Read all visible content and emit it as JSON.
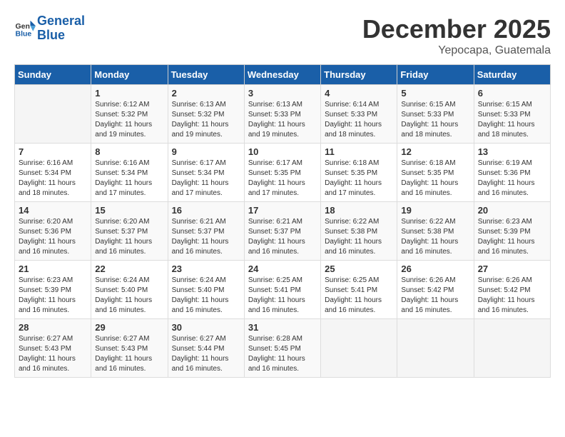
{
  "header": {
    "logo_line1": "General",
    "logo_line2": "Blue",
    "month": "December 2025",
    "location": "Yepocapa, Guatemala"
  },
  "days_of_week": [
    "Sunday",
    "Monday",
    "Tuesday",
    "Wednesday",
    "Thursday",
    "Friday",
    "Saturday"
  ],
  "weeks": [
    [
      {
        "num": "",
        "sunrise": "",
        "sunset": "",
        "daylight": ""
      },
      {
        "num": "1",
        "sunrise": "Sunrise: 6:12 AM",
        "sunset": "Sunset: 5:32 PM",
        "daylight": "Daylight: 11 hours and 19 minutes."
      },
      {
        "num": "2",
        "sunrise": "Sunrise: 6:13 AM",
        "sunset": "Sunset: 5:32 PM",
        "daylight": "Daylight: 11 hours and 19 minutes."
      },
      {
        "num": "3",
        "sunrise": "Sunrise: 6:13 AM",
        "sunset": "Sunset: 5:33 PM",
        "daylight": "Daylight: 11 hours and 19 minutes."
      },
      {
        "num": "4",
        "sunrise": "Sunrise: 6:14 AM",
        "sunset": "Sunset: 5:33 PM",
        "daylight": "Daylight: 11 hours and 18 minutes."
      },
      {
        "num": "5",
        "sunrise": "Sunrise: 6:15 AM",
        "sunset": "Sunset: 5:33 PM",
        "daylight": "Daylight: 11 hours and 18 minutes."
      },
      {
        "num": "6",
        "sunrise": "Sunrise: 6:15 AM",
        "sunset": "Sunset: 5:33 PM",
        "daylight": "Daylight: 11 hours and 18 minutes."
      }
    ],
    [
      {
        "num": "7",
        "sunrise": "Sunrise: 6:16 AM",
        "sunset": "Sunset: 5:34 PM",
        "daylight": "Daylight: 11 hours and 18 minutes."
      },
      {
        "num": "8",
        "sunrise": "Sunrise: 6:16 AM",
        "sunset": "Sunset: 5:34 PM",
        "daylight": "Daylight: 11 hours and 17 minutes."
      },
      {
        "num": "9",
        "sunrise": "Sunrise: 6:17 AM",
        "sunset": "Sunset: 5:34 PM",
        "daylight": "Daylight: 11 hours and 17 minutes."
      },
      {
        "num": "10",
        "sunrise": "Sunrise: 6:17 AM",
        "sunset": "Sunset: 5:35 PM",
        "daylight": "Daylight: 11 hours and 17 minutes."
      },
      {
        "num": "11",
        "sunrise": "Sunrise: 6:18 AM",
        "sunset": "Sunset: 5:35 PM",
        "daylight": "Daylight: 11 hours and 17 minutes."
      },
      {
        "num": "12",
        "sunrise": "Sunrise: 6:18 AM",
        "sunset": "Sunset: 5:35 PM",
        "daylight": "Daylight: 11 hours and 16 minutes."
      },
      {
        "num": "13",
        "sunrise": "Sunrise: 6:19 AM",
        "sunset": "Sunset: 5:36 PM",
        "daylight": "Daylight: 11 hours and 16 minutes."
      }
    ],
    [
      {
        "num": "14",
        "sunrise": "Sunrise: 6:20 AM",
        "sunset": "Sunset: 5:36 PM",
        "daylight": "Daylight: 11 hours and 16 minutes."
      },
      {
        "num": "15",
        "sunrise": "Sunrise: 6:20 AM",
        "sunset": "Sunset: 5:37 PM",
        "daylight": "Daylight: 11 hours and 16 minutes."
      },
      {
        "num": "16",
        "sunrise": "Sunrise: 6:21 AM",
        "sunset": "Sunset: 5:37 PM",
        "daylight": "Daylight: 11 hours and 16 minutes."
      },
      {
        "num": "17",
        "sunrise": "Sunrise: 6:21 AM",
        "sunset": "Sunset: 5:37 PM",
        "daylight": "Daylight: 11 hours and 16 minutes."
      },
      {
        "num": "18",
        "sunrise": "Sunrise: 6:22 AM",
        "sunset": "Sunset: 5:38 PM",
        "daylight": "Daylight: 11 hours and 16 minutes."
      },
      {
        "num": "19",
        "sunrise": "Sunrise: 6:22 AM",
        "sunset": "Sunset: 5:38 PM",
        "daylight": "Daylight: 11 hours and 16 minutes."
      },
      {
        "num": "20",
        "sunrise": "Sunrise: 6:23 AM",
        "sunset": "Sunset: 5:39 PM",
        "daylight": "Daylight: 11 hours and 16 minutes."
      }
    ],
    [
      {
        "num": "21",
        "sunrise": "Sunrise: 6:23 AM",
        "sunset": "Sunset: 5:39 PM",
        "daylight": "Daylight: 11 hours and 16 minutes."
      },
      {
        "num": "22",
        "sunrise": "Sunrise: 6:24 AM",
        "sunset": "Sunset: 5:40 PM",
        "daylight": "Daylight: 11 hours and 16 minutes."
      },
      {
        "num": "23",
        "sunrise": "Sunrise: 6:24 AM",
        "sunset": "Sunset: 5:40 PM",
        "daylight": "Daylight: 11 hours and 16 minutes."
      },
      {
        "num": "24",
        "sunrise": "Sunrise: 6:25 AM",
        "sunset": "Sunset: 5:41 PM",
        "daylight": "Daylight: 11 hours and 16 minutes."
      },
      {
        "num": "25",
        "sunrise": "Sunrise: 6:25 AM",
        "sunset": "Sunset: 5:41 PM",
        "daylight": "Daylight: 11 hours and 16 minutes."
      },
      {
        "num": "26",
        "sunrise": "Sunrise: 6:26 AM",
        "sunset": "Sunset: 5:42 PM",
        "daylight": "Daylight: 11 hours and 16 minutes."
      },
      {
        "num": "27",
        "sunrise": "Sunrise: 6:26 AM",
        "sunset": "Sunset: 5:42 PM",
        "daylight": "Daylight: 11 hours and 16 minutes."
      }
    ],
    [
      {
        "num": "28",
        "sunrise": "Sunrise: 6:27 AM",
        "sunset": "Sunset: 5:43 PM",
        "daylight": "Daylight: 11 hours and 16 minutes."
      },
      {
        "num": "29",
        "sunrise": "Sunrise: 6:27 AM",
        "sunset": "Sunset: 5:43 PM",
        "daylight": "Daylight: 11 hours and 16 minutes."
      },
      {
        "num": "30",
        "sunrise": "Sunrise: 6:27 AM",
        "sunset": "Sunset: 5:44 PM",
        "daylight": "Daylight: 11 hours and 16 minutes."
      },
      {
        "num": "31",
        "sunrise": "Sunrise: 6:28 AM",
        "sunset": "Sunset: 5:45 PM",
        "daylight": "Daylight: 11 hours and 16 minutes."
      },
      {
        "num": "",
        "sunrise": "",
        "sunset": "",
        "daylight": ""
      },
      {
        "num": "",
        "sunrise": "",
        "sunset": "",
        "daylight": ""
      },
      {
        "num": "",
        "sunrise": "",
        "sunset": "",
        "daylight": ""
      }
    ]
  ]
}
